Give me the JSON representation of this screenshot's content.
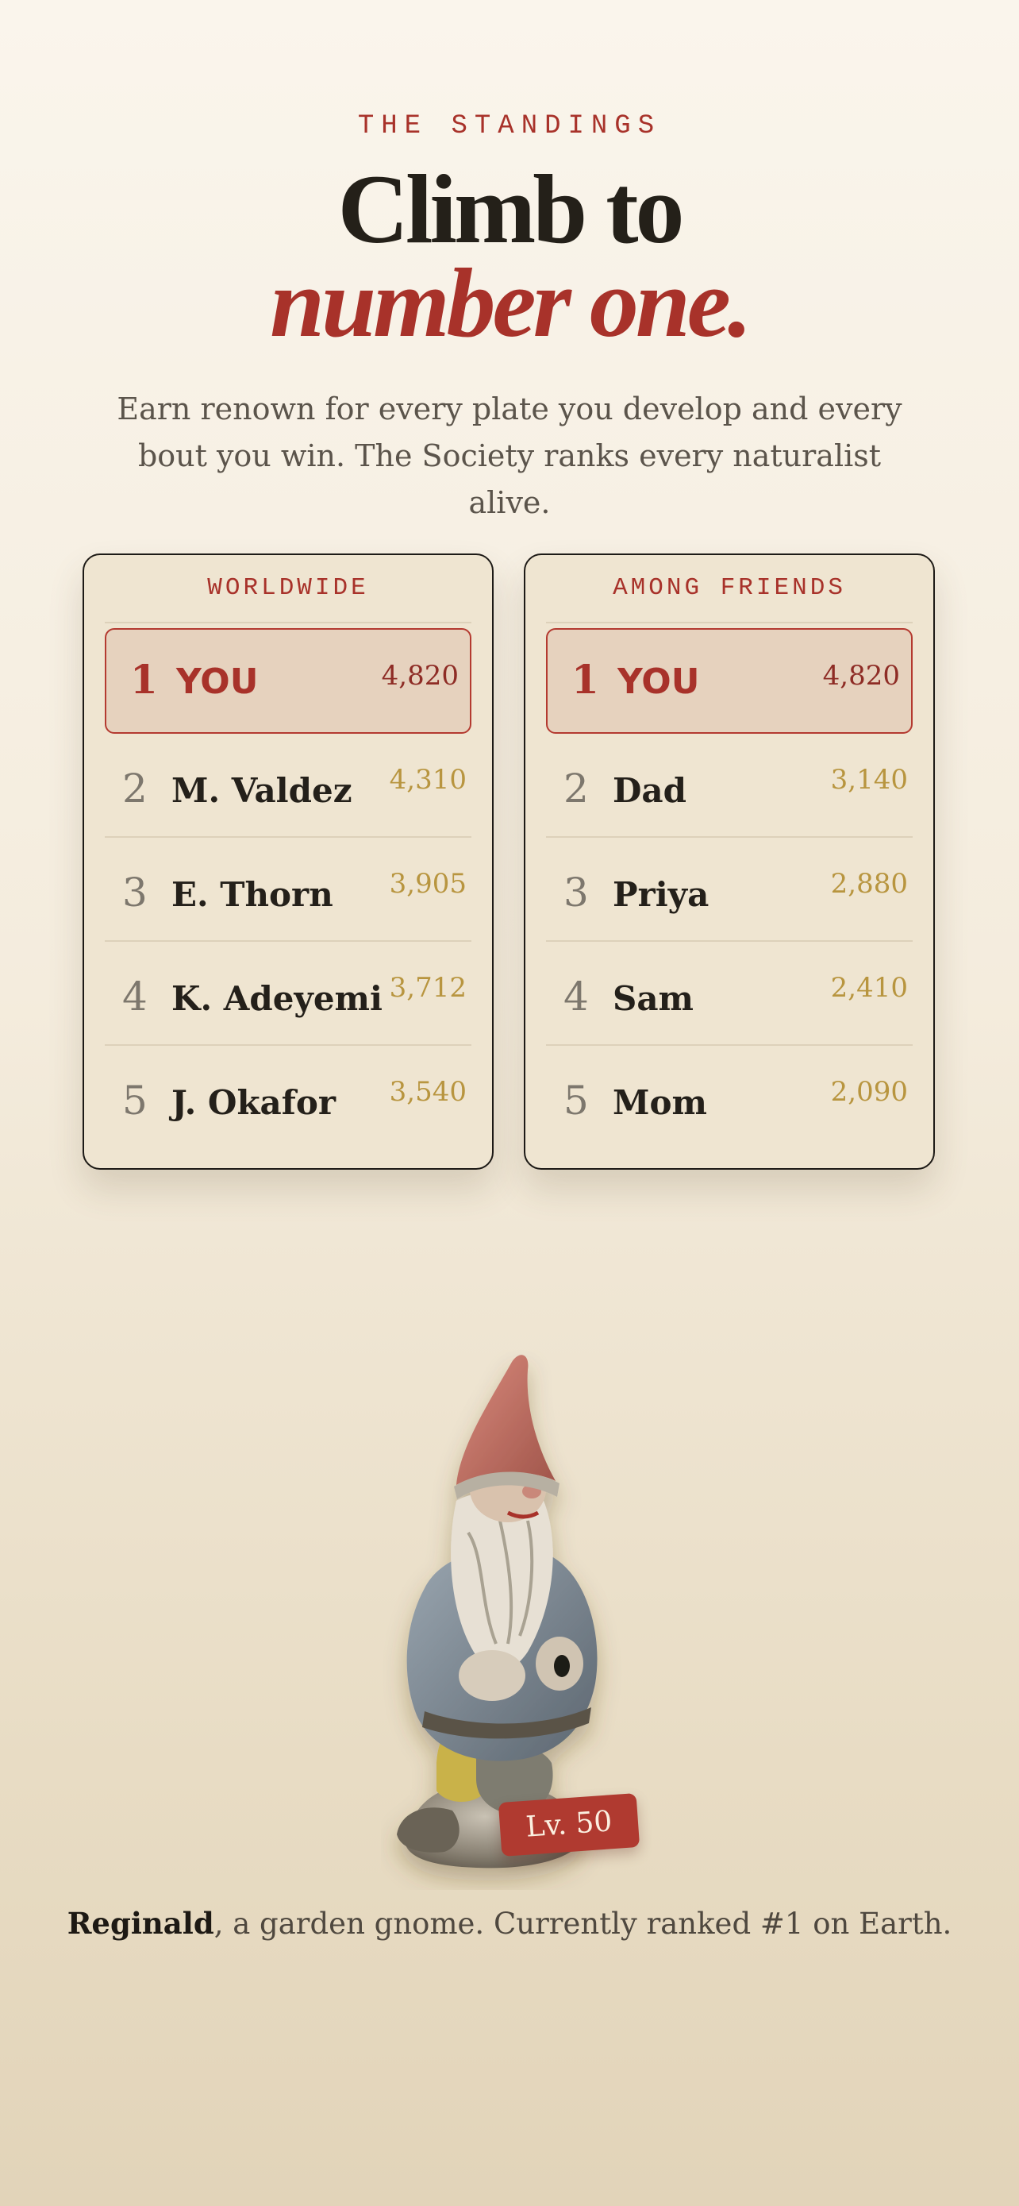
{
  "header": {
    "eyebrow": "THE STANDINGS",
    "headline_line1": "Climb to",
    "headline_line2": "number one.",
    "intro": "Earn renown for every plate you develop and every bout you win. The Society ranks every naturalist alive."
  },
  "boards": {
    "worldwide": {
      "title": "WORLDWIDE",
      "rows": [
        {
          "rank": "1",
          "name": "YOU",
          "points": "4,820"
        },
        {
          "rank": "2",
          "name": "M. Valdez",
          "points": "4,310"
        },
        {
          "rank": "3",
          "name": "E. Thorn",
          "points": "3,905"
        },
        {
          "rank": "4",
          "name": "K. Adeyemi",
          "points": "3,712"
        },
        {
          "rank": "5",
          "name": "J. Okafor",
          "points": "3,540"
        }
      ]
    },
    "friends": {
      "title": "AMONG FRIENDS",
      "rows": [
        {
          "rank": "1",
          "name": "YOU",
          "points": "4,820"
        },
        {
          "rank": "2",
          "name": "Dad",
          "points": "3,140"
        },
        {
          "rank": "3",
          "name": "Priya",
          "points": "2,880"
        },
        {
          "rank": "4",
          "name": "Sam",
          "points": "2,410"
        },
        {
          "rank": "5",
          "name": "Mom",
          "points": "2,090"
        }
      ]
    }
  },
  "mascot": {
    "icon": "garden-gnome-figurine",
    "level_badge": "Lv. 50"
  },
  "caption": {
    "name": "Reginald",
    "text": ", a garden gnome. Currently ranked #1 on Earth."
  },
  "colors": {
    "accent": "#a8322a",
    "gold": "#b8953f",
    "card": "#efe5d1",
    "ink": "#242019"
  }
}
